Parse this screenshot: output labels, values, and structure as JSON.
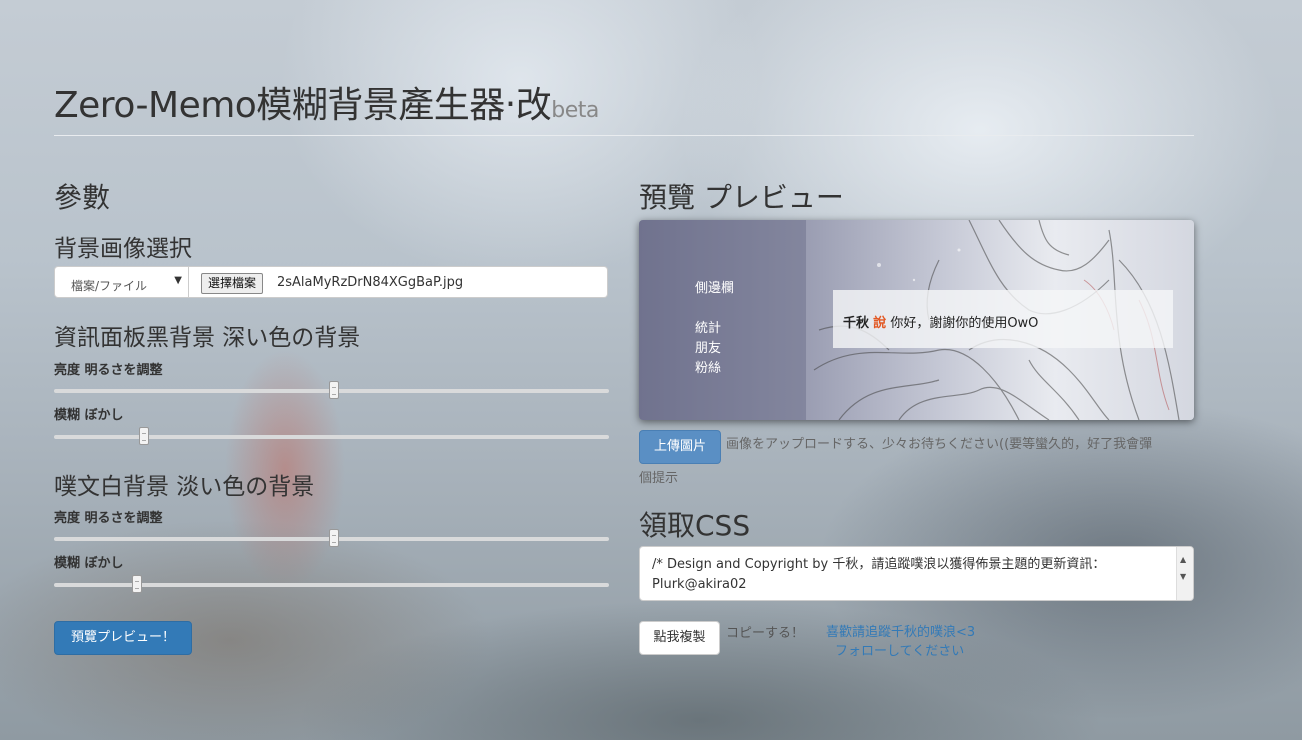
{
  "header": {
    "title": "Zero-Memo模糊背景產生器‧改",
    "badge": "beta"
  },
  "params": {
    "heading": "參數",
    "bg_select": {
      "heading": "背景画像選択",
      "source_value": "檔案/ファイル",
      "file_button": "選擇檔案",
      "file_name": "2sAlaMyRzDrN84XGgBaP.jpg"
    },
    "dark_panel": {
      "heading": "資訊面板黑背景 深い色の背景",
      "brightness_label": "亮度 明るさを調整",
      "brightness_value": 50,
      "blur_label": "模糊 ぼかし",
      "blur_value": 16
    },
    "light_panel": {
      "heading": "噗文白背景 淡い色の背景",
      "brightness_label": "亮度 明るさを調整",
      "brightness_value": 50,
      "blur_label": "模糊 ぼかし",
      "blur_value": 15
    },
    "preview_button": "預覽プレビュー！"
  },
  "preview": {
    "heading": "預覽 プレビュー",
    "sidebar": {
      "title": "側邊欄",
      "items": [
        "統計",
        "朋友",
        "粉絲"
      ]
    },
    "plurk": {
      "user": "千秋",
      "verb": "說",
      "text": "你好，謝謝你的使用OwO"
    }
  },
  "upload": {
    "button": "上傳圖片",
    "note_line1": "画像をアップロードする、少々お待ちください((要等蠻久的，好了我會彈",
    "note_line2": "個提示"
  },
  "css": {
    "heading": "領取CSS",
    "line1": "/* Design and Copyright by 千秋，請追蹤噗浪以獲得佈景主題的更新資訊：",
    "line2": "Plurk@akira02",
    "copy_button": "點我複製",
    "copy_note": "コピーする！",
    "follow_link": "喜歡請追蹤千秋的噗浪<3",
    "follow_note": "フォローしてください"
  },
  "colors": {
    "primary": "#337ab7",
    "plurk_says": "#e25823"
  }
}
